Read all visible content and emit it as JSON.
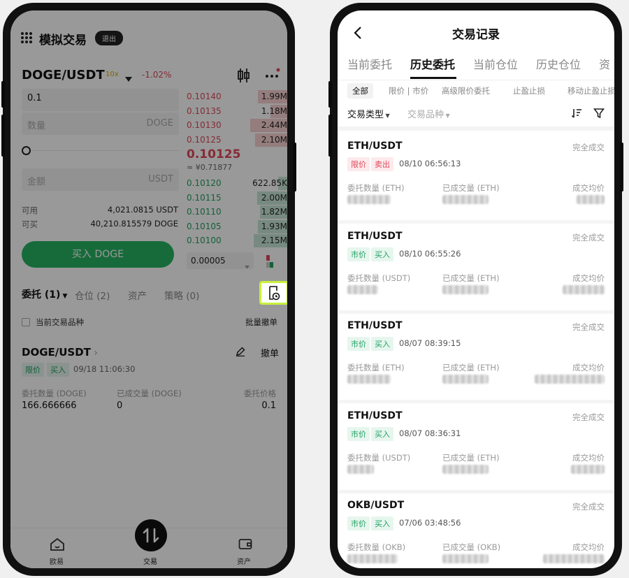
{
  "left": {
    "header": {
      "title": "模拟交易",
      "exit_label": "退出"
    },
    "pair": {
      "symbol": "DOGE/USDT",
      "leverage": "10x",
      "change": "-1.02%"
    },
    "form": {
      "price_value": "0.1",
      "quantity_placeholder": "数量",
      "quantity_unit": "DOGE",
      "amount_placeholder": "金额",
      "amount_unit": "USDT",
      "available_label": "可用",
      "available_value": "4,021.0815 USDT",
      "buyable_label": "可买",
      "buyable_value": "40,210.815579 DOGE",
      "buy_button": "买入 DOGE"
    },
    "orderbook": {
      "asks": [
        {
          "price": "0.10140",
          "qty": "1.99M",
          "depth": 0.3
        },
        {
          "price": "0.10135",
          "qty": "1.18M",
          "depth": 0.18
        },
        {
          "price": "0.10130",
          "qty": "2.44M",
          "depth": 0.38
        },
        {
          "price": "0.10125",
          "qty": "2.10M",
          "depth": 0.33
        }
      ],
      "last_price": "0.10125",
      "last_price_cny": "≈ ¥0.71877",
      "bids": [
        {
          "price": "0.10120",
          "qty": "622.85K",
          "depth": 0.1
        },
        {
          "price": "0.10115",
          "qty": "2.00M",
          "depth": 0.31
        },
        {
          "price": "0.10110",
          "qty": "1.82M",
          "depth": 0.28
        },
        {
          "price": "0.10105",
          "qty": "1.93M",
          "depth": 0.3
        },
        {
          "price": "0.10100",
          "qty": "2.15M",
          "depth": 0.34
        }
      ],
      "precision": "0.00005"
    },
    "tabs": [
      "委托 (1)",
      "仓位 (2)",
      "资产",
      "策略 (0)"
    ],
    "filter_label": "当前交易品种",
    "batch_cancel": "批量撤单",
    "order": {
      "pair": "DOGE/USDT",
      "type_tag": "限价",
      "side_tag": "买入",
      "time": "09/18 11:06:30",
      "cancel_label": "撤单",
      "qty_label": "委托数量 (DOGE)",
      "qty_value": "166.666666",
      "filled_label": "已成交量 (DOGE)",
      "filled_value": "0",
      "price_label": "委托价格",
      "price_value": "0.1"
    },
    "bottom_nav": [
      "欧易",
      "交易",
      "资产"
    ]
  },
  "right": {
    "title": "交易记录",
    "tabs": [
      "当前委托",
      "历史委托",
      "当前仓位",
      "历史仓位",
      "资"
    ],
    "active_tab": 1,
    "chips": [
      "全部",
      "限价 | 市价",
      "高级限价委托",
      "止盈止损",
      "移动止盈止损"
    ],
    "filters": [
      "交易类型",
      "交易品种"
    ],
    "records": [
      {
        "pair": "ETH/USDT",
        "status": "完全成交",
        "type": "限价",
        "side": "卖出",
        "side_color": "red",
        "time": "08/10 06:56:13",
        "qty_label": "委托数量 (ETH)",
        "filled_label": "已成交量 (ETH)",
        "avg_label": "成交均价"
      },
      {
        "pair": "ETH/USDT",
        "status": "完全成交",
        "type": "市价",
        "side": "买入",
        "side_color": "green",
        "time": "08/10 06:55:26",
        "qty_label": "委托数量 (USDT)",
        "filled_label": "已成交量 (ETH)",
        "avg_label": "成交均价"
      },
      {
        "pair": "ETH/USDT",
        "status": "完全成交",
        "type": "市价",
        "side": "买入",
        "side_color": "green",
        "time": "08/07 08:39:15",
        "qty_label": "委托数量 (ETH)",
        "filled_label": "已成交量 (ETH)",
        "avg_label": "成交均价"
      },
      {
        "pair": "ETH/USDT",
        "status": "完全成交",
        "type": "市价",
        "side": "买入",
        "side_color": "green",
        "time": "08/07 08:36:31",
        "qty_label": "委托数量 (USDT)",
        "filled_label": "已成交量 (ETH)",
        "avg_label": "成交均价"
      },
      {
        "pair": "OKB/USDT",
        "status": "完全成交",
        "type": "市价",
        "side": "买入",
        "side_color": "green",
        "time": "07/06 03:48:56",
        "qty_label": "委托数量 (OKB)",
        "filled_label": "已成交量 (OKB)",
        "avg_label": "成交均价"
      }
    ]
  },
  "colors": {
    "buy": "#22a060",
    "sell": "#e0485a",
    "highlight": "#c8f03c"
  }
}
